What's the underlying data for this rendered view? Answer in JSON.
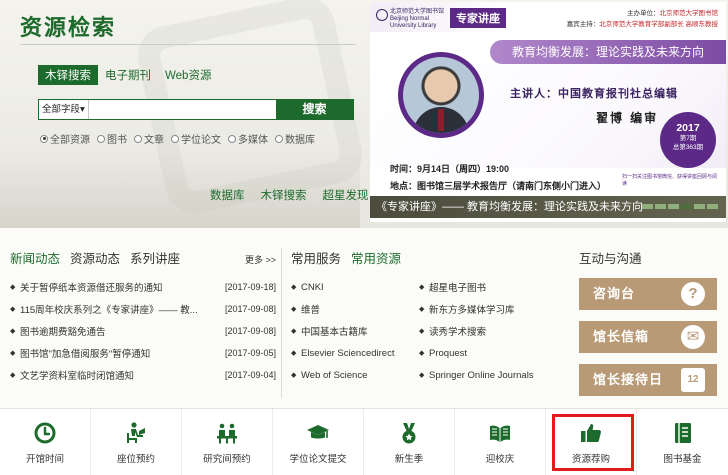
{
  "search": {
    "title": "资源检索",
    "tabs": [
      "木铎搜索",
      "电子期刊",
      "Web资源"
    ],
    "active_tab": 0,
    "field_select": "全部字段▾",
    "query_value": "",
    "button_label": "搜索",
    "radio_options": [
      "全部资源",
      "图书",
      "文章",
      "学位论文",
      "多媒体",
      "数据库"
    ],
    "selected_radio": 0,
    "quick_links": [
      "数据库",
      "木铎搜索",
      "超星发现"
    ]
  },
  "poster": {
    "logo_text": "北京师范大学图书馆 Beijing Normal University Library",
    "badge": "专家讲座",
    "org_line1_label": "主办单位：",
    "org_line1_value": "北京师范大学图书馆",
    "org_line2_label": "嘉宾主持：",
    "org_line2_value": "北京师范大学教育学部副部长 高顺东教授",
    "title": "教育均衡发展：理论实践及未来方向",
    "speaker_label": "主讲人：中国教育报刊社总编辑",
    "speaker_name": "翟博 编审",
    "period_year": "2017",
    "period_issue": "第7期",
    "period_total": "总第363期",
    "time": "时间：9月14日（周四）19:00",
    "place": "地点：图书馆三层学术报告厅（请南门东侧小门进入）",
    "qr_note": "扫一扫关注图书馆微信、获得讲座回顾与阅读",
    "caption": "《专家讲座》—— 教育均衡发展：理论实践及未来方向"
  },
  "news": {
    "tabs": [
      "新闻动态",
      "资源动态",
      "系列讲座"
    ],
    "active_tab": 0,
    "more": "更多 >>",
    "items": [
      {
        "title": "关于暂停纸本资源借还服务的通知",
        "date": "[2017-09-18]"
      },
      {
        "title": "115周年校庆系列之《专家讲座》—— 教...",
        "date": "[2017-09-08]"
      },
      {
        "title": "图书逾期费豁免通告",
        "date": "[2017-09-08]"
      },
      {
        "title": "图书馆\"加急借阅服务\"暂停通知",
        "date": "[2017-09-05]"
      },
      {
        "title": "文艺学资料室临时闭馆通知",
        "date": "[2017-09-04]"
      }
    ]
  },
  "resources": {
    "tabs": [
      "常用服务",
      "常用资源"
    ],
    "active_tab": 1,
    "left": [
      "CNKI",
      "维普",
      "中国基本古籍库",
      "Elsevier Sciencedirect",
      "Web of Science"
    ],
    "right": [
      "超星电子图书",
      "新东方多媒体学习库",
      "读秀学术搜索",
      "Proquest",
      "Springer Online Journals"
    ]
  },
  "interact": {
    "title": "互动与沟通",
    "buttons": [
      {
        "label": "咨询台",
        "icon": "?"
      },
      {
        "label": "馆长信箱",
        "icon": "✉"
      },
      {
        "label": "馆长接待日",
        "icon": "12"
      }
    ],
    "colors": {
      "button": "#b89a76"
    }
  },
  "bottom": {
    "items": [
      {
        "label": "开馆时间",
        "icon": "clock-icon"
      },
      {
        "label": "座位预约",
        "icon": "seat-reading-icon"
      },
      {
        "label": "研究间预约",
        "icon": "meeting-room-icon"
      },
      {
        "label": "学位论文提交",
        "icon": "graduation-cap-icon"
      },
      {
        "label": "新生季",
        "icon": "medal-icon"
      },
      {
        "label": "迎校庆",
        "icon": "open-book-icon"
      },
      {
        "label": "资源荐购",
        "icon": "thumbs-up-icon"
      },
      {
        "label": "图书基金",
        "icon": "bookshelf-icon"
      }
    ],
    "highlighted_index": 6
  },
  "colors": {
    "brand_green": "#1d6b2c",
    "poster_purple": "#5c2a86",
    "highlight_red": "#e31b1b"
  }
}
